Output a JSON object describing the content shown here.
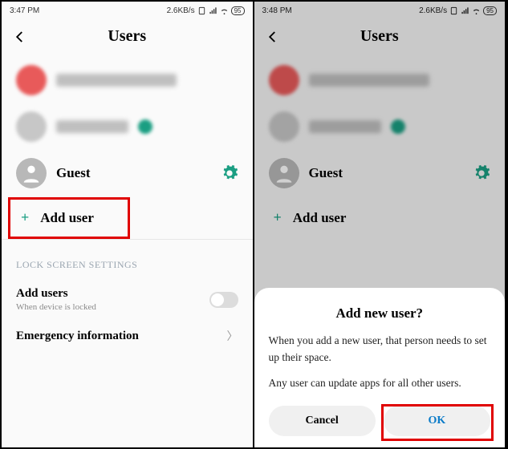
{
  "left": {
    "status": {
      "time": "3:47 PM",
      "net": "2.6KB/s",
      "battery": "95"
    },
    "title": "Users",
    "guest": "Guest",
    "add_user": "Add user",
    "section_label": "LOCK SCREEN SETTINGS",
    "add_users_title": "Add users",
    "add_users_sub": "When device is locked",
    "emergency": "Emergency information"
  },
  "right": {
    "status": {
      "time": "3:48 PM",
      "net": "2.6KB/s",
      "battery": "95"
    },
    "title": "Users",
    "guest": "Guest",
    "add_user": "Add user",
    "dialog": {
      "title": "Add new user?",
      "p1": "When you add a new user, that person needs to set up their space.",
      "p2": "Any user can update apps for all other users.",
      "cancel": "Cancel",
      "ok": "OK"
    }
  }
}
